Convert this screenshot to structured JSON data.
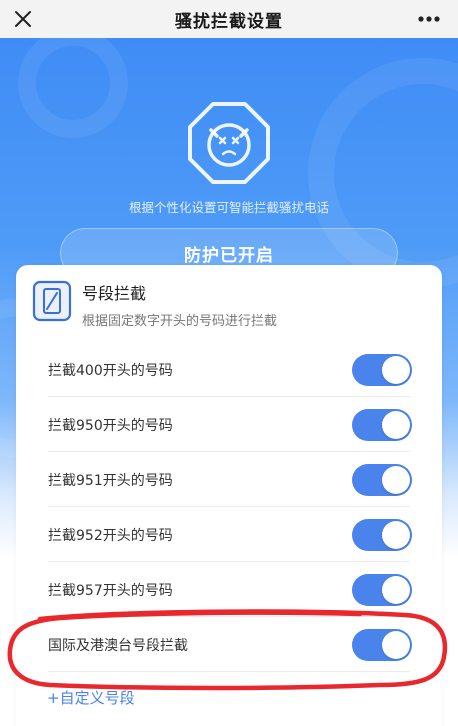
{
  "navbar": {
    "title": "骚扰拦截设置",
    "close_icon": "close-icon",
    "more_icon": "more-dots-icon"
  },
  "hero": {
    "description": "根据个性化设置可智能拦截骚扰电话",
    "status_button": "防护已开启",
    "shield_icon": "shield-face-icon"
  },
  "card": {
    "title": "号段拦截",
    "subtitle": "根据固定数字开头的号码进行拦截",
    "icon": "phone-card-icon",
    "rows": [
      {
        "label": "拦截400开头的号码",
        "enabled": true
      },
      {
        "label": "拦截950开头的号码",
        "enabled": true
      },
      {
        "label": "拦截951开头的号码",
        "enabled": true
      },
      {
        "label": "拦截952开头的号码",
        "enabled": true
      },
      {
        "label": "拦截957开头的号码",
        "enabled": true
      },
      {
        "label": "国际及港澳台号段拦截",
        "enabled": true
      }
    ],
    "custom_link": "+自定义号段"
  },
  "colors": {
    "accent": "#4a83ec",
    "hero_top": "#3f8cf6",
    "annotation": "#e8282d"
  }
}
